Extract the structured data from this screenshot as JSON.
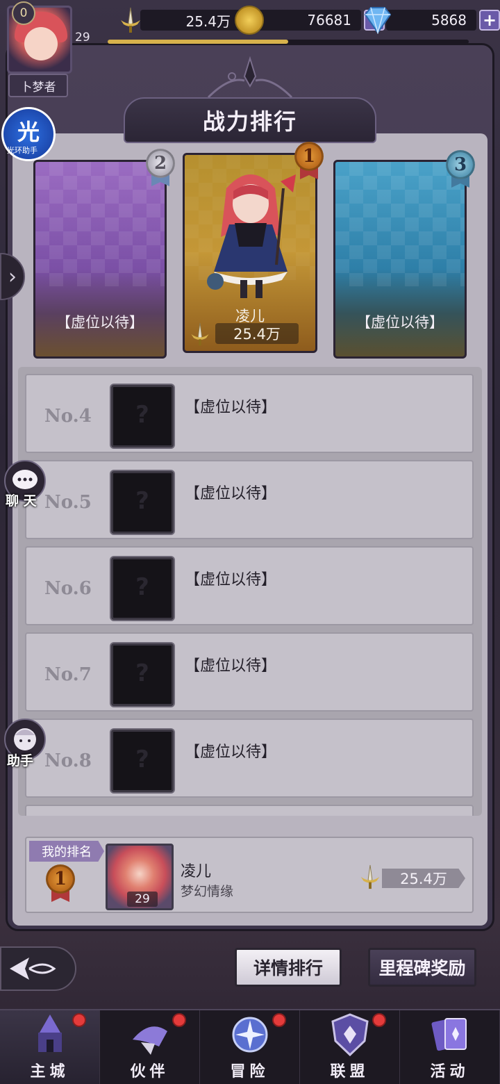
{
  "player": {
    "level": "29",
    "vip": "0",
    "title": "卜梦者",
    "xp_fraction": 0.5
  },
  "resources": {
    "power": "25.4万",
    "gold": "76681",
    "gems": "5868"
  },
  "panel_title": "战力排行",
  "top3": [
    {
      "rank": "2",
      "label": "【虚位以待】"
    },
    {
      "rank": "1",
      "name": "凌儿",
      "power": "25.4万"
    },
    {
      "rank": "3",
      "label": "【虚位以待】"
    }
  ],
  "list": [
    {
      "rank": "No.4",
      "name": "【虚位以待】"
    },
    {
      "rank": "No.5",
      "name": "【虚位以待】"
    },
    {
      "rank": "No.6",
      "name": "【虚位以待】"
    },
    {
      "rank": "No.7",
      "name": "【虚位以待】"
    },
    {
      "rank": "No.8",
      "name": "【虚位以待】"
    }
  ],
  "my_rank": {
    "tag": "我的排名",
    "rank": "1",
    "name": "凌儿",
    "subtitle": "梦幻情缘",
    "level": "29",
    "power": "25.4万"
  },
  "side": {
    "guang": "光",
    "guang_label": "光环助手",
    "chat": "聊 天",
    "helper": "助手"
  },
  "actions": {
    "detail": "详情排行",
    "milestone": "里程碑奖励"
  },
  "nav": [
    {
      "label": "主城",
      "badge": true
    },
    {
      "label": "伙伴",
      "badge": true
    },
    {
      "label": "冒险",
      "badge": true
    },
    {
      "label": "联盟",
      "badge": true
    },
    {
      "label": "活动",
      "badge": false
    }
  ],
  "colors": {
    "gold": "#d7b24c",
    "accent_purple": "#6a5aa8",
    "badge_red": "#e43b3b"
  }
}
